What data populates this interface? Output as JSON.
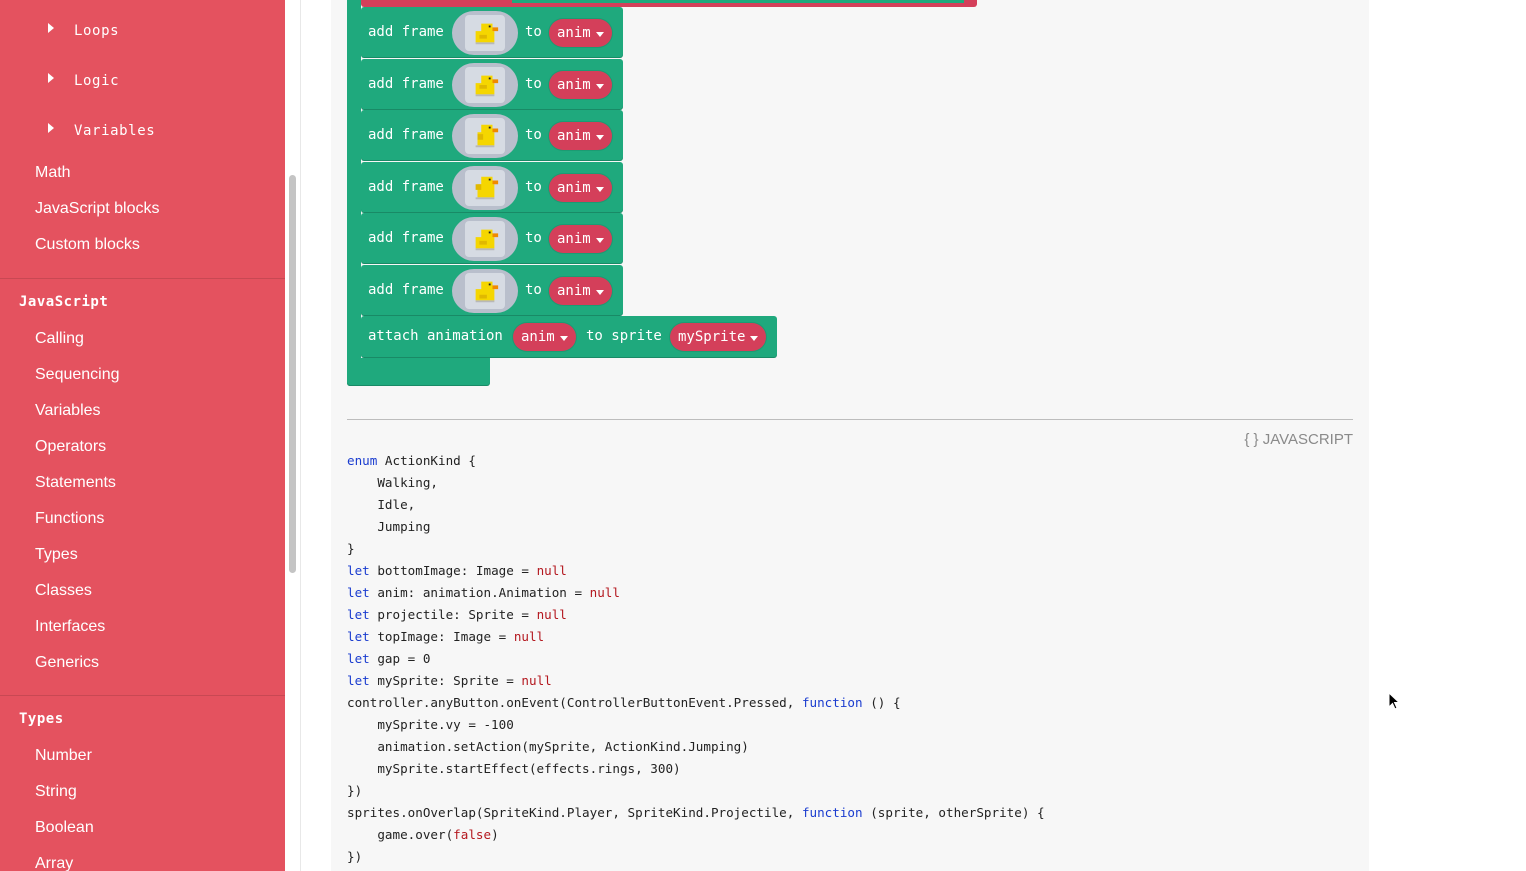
{
  "sidebar": {
    "tree_items": [
      {
        "label": "Loops"
      },
      {
        "label": "Logic"
      },
      {
        "label": "Variables"
      }
    ],
    "blocks_links": [
      "Math",
      "JavaScript blocks",
      "Custom blocks"
    ],
    "javascript_section": {
      "title": "JavaScript",
      "links": [
        "Calling",
        "Sequencing",
        "Variables",
        "Operators",
        "Statements",
        "Functions",
        "Types",
        "Classes",
        "Interfaces",
        "Generics"
      ]
    },
    "types_section": {
      "title": "Types",
      "links": [
        "Number",
        "String",
        "Boolean",
        "Array"
      ]
    }
  },
  "blocks": {
    "add_frame_rows": [
      {
        "add_frame": "add frame",
        "to": "to",
        "var": "anim"
      },
      {
        "add_frame": "add frame",
        "to": "to",
        "var": "anim"
      },
      {
        "add_frame": "add frame",
        "to": "to",
        "var": "anim"
      },
      {
        "add_frame": "add frame",
        "to": "to",
        "var": "anim"
      },
      {
        "add_frame": "add frame",
        "to": "to",
        "var": "anim"
      },
      {
        "add_frame": "add frame",
        "to": "to",
        "var": "anim"
      }
    ],
    "attach": {
      "label": "attach animation",
      "anim": "anim",
      "to_sprite": "to sprite",
      "sprite": "mySprite"
    }
  },
  "code": {
    "language_label": "{ } JAVASCRIPT",
    "lines": [
      [
        {
          "t": "enum",
          "c": "kw"
        },
        {
          "t": " ActionKind {"
        }
      ],
      [
        {
          "t": "    Walking,"
        }
      ],
      [
        {
          "t": "    Idle,"
        }
      ],
      [
        {
          "t": "    Jumping"
        }
      ],
      [
        {
          "t": "}"
        }
      ],
      [
        {
          "t": "let",
          "c": "kw"
        },
        {
          "t": " bottomImage: Image = "
        },
        {
          "t": "null",
          "c": "lit"
        }
      ],
      [
        {
          "t": "let",
          "c": "kw"
        },
        {
          "t": " anim: animation.Animation = "
        },
        {
          "t": "null",
          "c": "lit"
        }
      ],
      [
        {
          "t": "let",
          "c": "kw"
        },
        {
          "t": " projectile: Sprite = "
        },
        {
          "t": "null",
          "c": "lit"
        }
      ],
      [
        {
          "t": "let",
          "c": "kw"
        },
        {
          "t": " topImage: Image = "
        },
        {
          "t": "null",
          "c": "lit"
        }
      ],
      [
        {
          "t": "let",
          "c": "kw"
        },
        {
          "t": " gap = 0"
        }
      ],
      [
        {
          "t": "let",
          "c": "kw"
        },
        {
          "t": " mySprite: Sprite = "
        },
        {
          "t": "null",
          "c": "lit"
        }
      ],
      [
        {
          "t": "controller.anyButton.onEvent(ControllerButtonEvent.Pressed, "
        },
        {
          "t": "function",
          "c": "kw"
        },
        {
          "t": " () {"
        }
      ],
      [
        {
          "t": "    mySprite.vy = -100"
        }
      ],
      [
        {
          "t": "    animation.setAction(mySprite, ActionKind.Jumping)"
        }
      ],
      [
        {
          "t": "    mySprite.startEffect(effects.rings, 300)"
        }
      ],
      [
        {
          "t": "})"
        }
      ],
      [
        {
          "t": "sprites.onOverlap(SpriteKind.Player, SpriteKind.Projectile, "
        },
        {
          "t": "function",
          "c": "kw"
        },
        {
          "t": " (sprite, otherSprite) {"
        }
      ],
      [
        {
          "t": "    game.over("
        },
        {
          "t": "false",
          "c": "lit"
        },
        {
          "t": ")"
        }
      ],
      [
        {
          "t": "})"
        }
      ]
    ]
  },
  "icons": {
    "tree_caret": "caret-right-icon",
    "dropdown": "dropdown-triangle-icon",
    "duck": "duck-sprite-icon",
    "cursor": "mouse-cursor-icon"
  },
  "colors": {
    "sidebar_bg": "#e4525f",
    "block_green": "#1fa97d",
    "dropdown_red": "#d43f5a",
    "keyword_blue": "#1a3ccf",
    "literal_red": "#b4181f"
  }
}
